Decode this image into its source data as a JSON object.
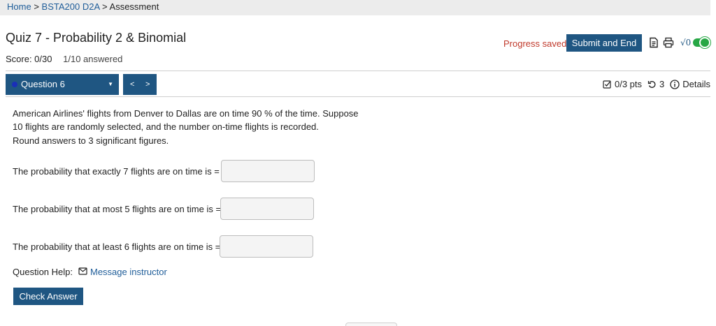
{
  "breadcrumb": {
    "home": "Home",
    "sep1": ">",
    "course": "BSTA200 D2A",
    "sep2": ">",
    "current": "Assessment"
  },
  "quiz": {
    "title": "Quiz 7 - Probability 2 & Binomial",
    "score": "Score: 0/30",
    "answered": "1/10 answered"
  },
  "toolbar": {
    "progress_saved": "Progress saved",
    "submit_label": "Submit and End",
    "sqrt_label": "√0",
    "icons": [
      "document-icon",
      "print-icon",
      "sqrt-icon",
      "toggle-switch"
    ],
    "toggle_on": true
  },
  "question_nav": {
    "selected": "Question 6",
    "prev_label": "<",
    "next_label": ">"
  },
  "question_meta": {
    "points": "0/3 pts",
    "attempts": "3",
    "details": "Details"
  },
  "question": {
    "text_line1": "American Airlines' flights from Denver to Dallas are on time 90 % of the time. Suppose",
    "text_line2": "10 flights are randomly selected, and the number on-time flights is recorded.",
    "text_line3": "Round answers to 3 significant figures.",
    "parts": [
      {
        "label": "The probability that exactly 7 flights are on time is =",
        "value": ""
      },
      {
        "label": "The probability that at most 5 flights are on time is =",
        "value": ""
      },
      {
        "label": "The probability that at least 6 flights are on time is =",
        "value": ""
      }
    ]
  },
  "help": {
    "label": "Question Help:",
    "message_label": "Message instructor"
  },
  "check_answer_label": "Check Answer",
  "colors": {
    "primary": "#1f5682",
    "link": "#1f5d99",
    "saved": "#c0392b",
    "toggle": "#27a745"
  }
}
